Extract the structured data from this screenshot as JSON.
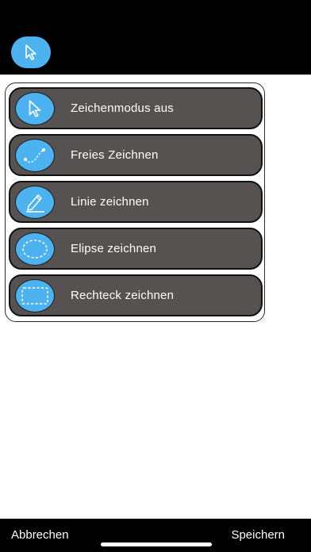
{
  "menu": {
    "items": [
      {
        "label": "Zeichenmodus aus",
        "icon": "cursor-arrow-icon"
      },
      {
        "label": "Freies Zeichnen",
        "icon": "freehand-curve-icon"
      },
      {
        "label": "Linie zeichnen",
        "icon": "pencil-line-icon"
      },
      {
        "label": "Elipse zeichnen",
        "icon": "dashed-ellipse-icon"
      },
      {
        "label": "Rechteck zeichnen",
        "icon": "dashed-rectangle-icon"
      }
    ]
  },
  "bottom": {
    "cancel_label": "Abbrechen",
    "save_label": "Speichern"
  },
  "colors": {
    "accent": "#4db3f0",
    "item_bg": "#565251",
    "bars": "#000000"
  }
}
